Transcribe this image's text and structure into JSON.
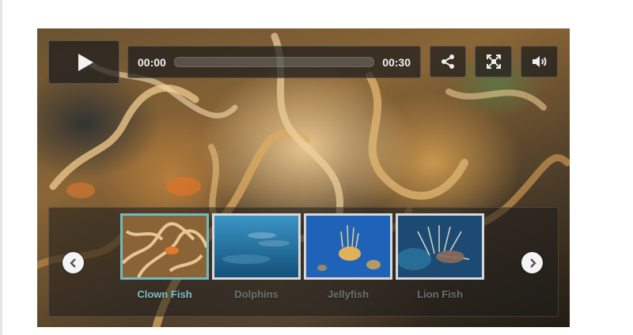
{
  "player": {
    "play_label": "Play",
    "current_time": "00:00",
    "duration": "00:30",
    "progress": 0.0,
    "buttons": {
      "share": "share-icon",
      "fullscreen": "fullscreen-icon",
      "volume": "volume-icon"
    }
  },
  "playlist": {
    "prev_icon": "chevron-left-icon",
    "next_icon": "chevron-right-icon",
    "selected_index": 0,
    "items": [
      {
        "title": "Clown Fish",
        "thumb": "clown-fish-thumbnail"
      },
      {
        "title": "Dolphins",
        "thumb": "dolphins-thumbnail"
      },
      {
        "title": "Jellyfish",
        "thumb": "jellyfish-thumbnail"
      },
      {
        "title": "Lion Fish",
        "thumb": "lion-fish-thumbnail"
      }
    ]
  },
  "colors": {
    "selected_accent": "#74b8c0",
    "control_bg": "#1c1c1c"
  }
}
